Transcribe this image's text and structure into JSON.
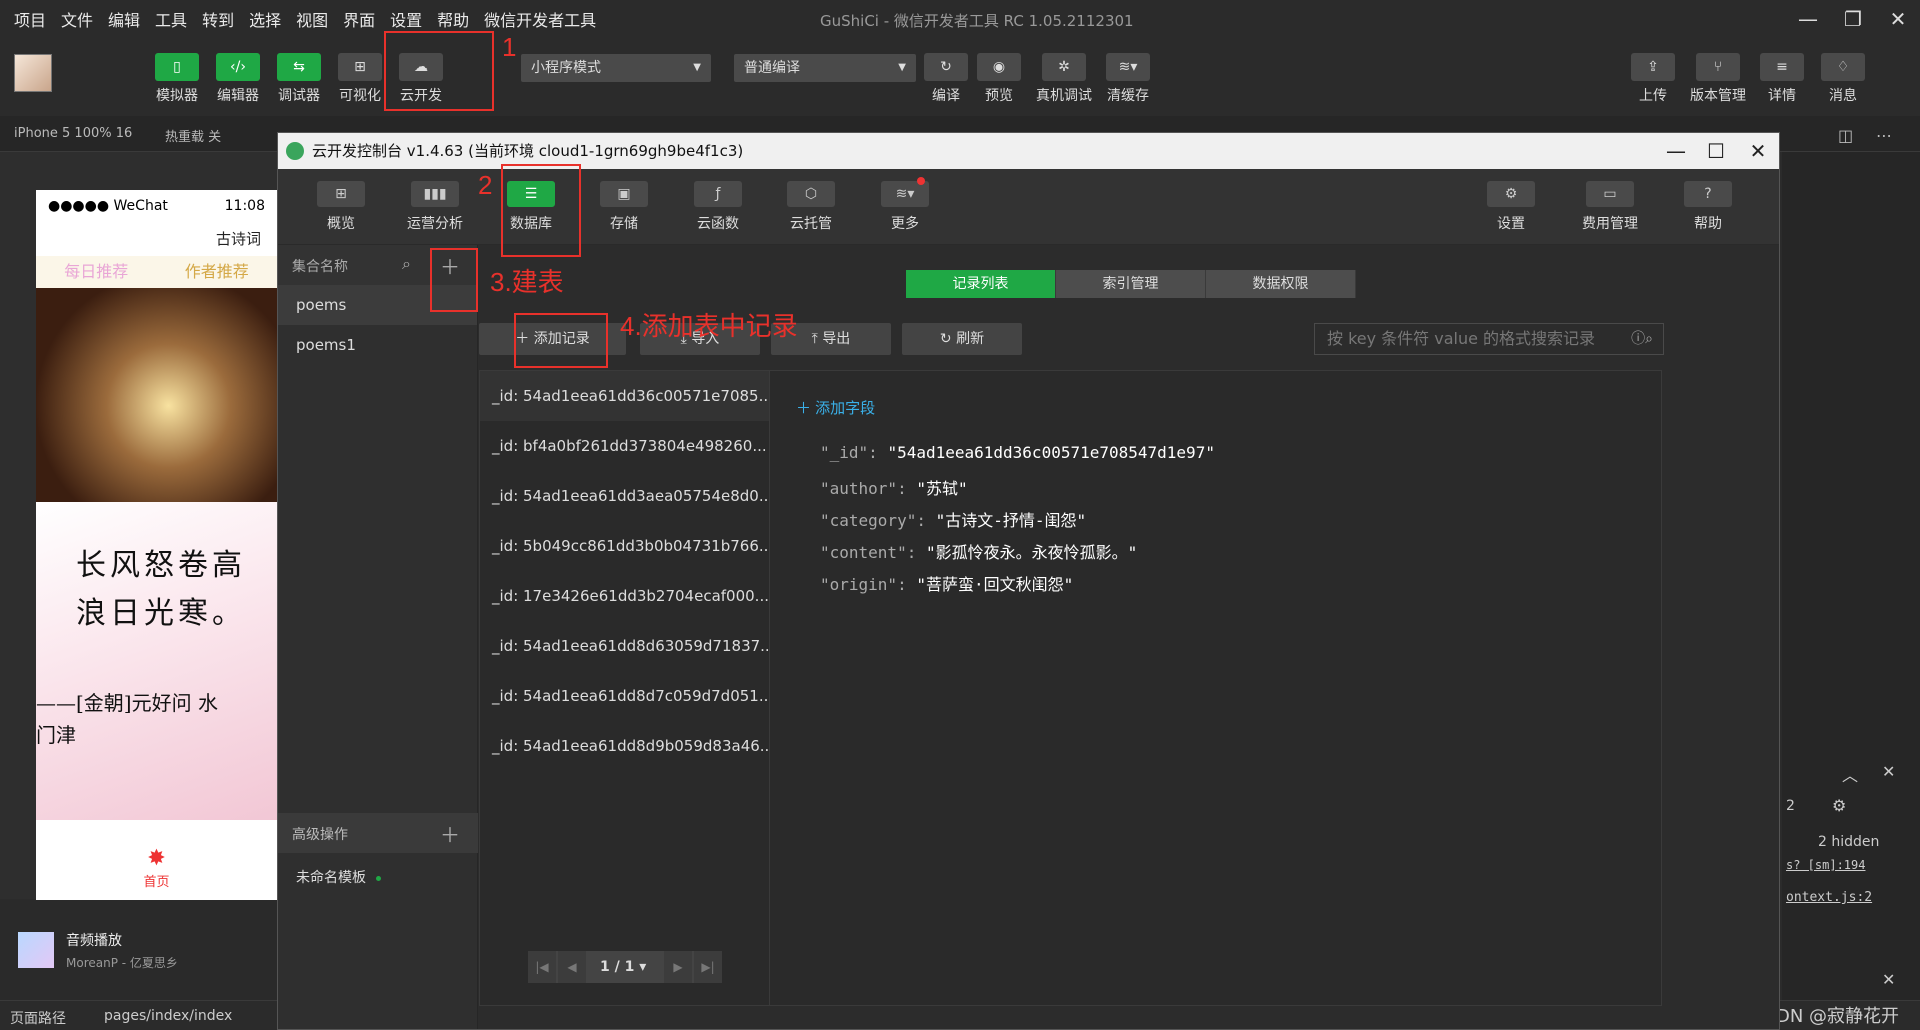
{
  "menubar": {
    "items": [
      "项目",
      "文件",
      "编辑",
      "工具",
      "转到",
      "选择",
      "视图",
      "界面",
      "设置",
      "帮助",
      "微信开发者工具"
    ],
    "title": "GuShiCi - 微信开发者工具 RC 1.05.2112301"
  },
  "toolbar": {
    "left": [
      "模拟器",
      "编辑器",
      "调试器",
      "可视化",
      "云开发"
    ],
    "mode_select": "小程序模式",
    "compile_select": "普通编译",
    "middle": [
      "编译",
      "预览",
      "真机调试",
      "清缓存"
    ],
    "right": [
      "上传",
      "版本管理",
      "详情",
      "消息"
    ]
  },
  "subbar": {
    "device": "iPhone 5 100% 16",
    "hot_reload": "热重载 关"
  },
  "phone": {
    "carrier": "●●●●● WeChat",
    "time": "11:08",
    "title": "古诗词",
    "tabs": [
      "每日推荐",
      "作者推荐"
    ],
    "poem_line1": "长风怒卷高",
    "poem_line2": "浪日光寒。",
    "poem_by": "——[金朝]元好问 水",
    "poem_by2": "门津",
    "home_label": "首页"
  },
  "audio": {
    "title": "音频播放",
    "subtitle": "MoreanP - 亿夏思乡"
  },
  "footer": {
    "path_label": "页面路径",
    "path": "pages/index/index",
    "watermark": "CSDN @寂静花开"
  },
  "right_panel": {
    "count": "2",
    "hidden": "2 hidden",
    "link1": "s? [sm]:194",
    "link2": "ontext.js:2"
  },
  "console": {
    "title": "云开发控制台 v1.4.63  (当前环境 cloud1-1grn69gh9be4f1c3)",
    "nav": [
      "概览",
      "运营分析",
      "数据库",
      "存储",
      "云函数",
      "云托管",
      "更多"
    ],
    "nav_right": [
      "设置",
      "费用管理",
      "帮助"
    ],
    "collection_header": "集合名称",
    "collections": [
      "poems",
      "poems1"
    ],
    "advanced": "高级操作",
    "template": "未命名模板",
    "tabs": [
      "记录列表",
      "索引管理",
      "数据权限"
    ],
    "actions": [
      "添加记录",
      "导入",
      "导出",
      "刷新"
    ],
    "search_placeholder": "按 key 条件符 value 的格式搜索记录",
    "records": [
      "_id: 54ad1eea61dd36c00571e7085...",
      "_id: bf4a0bf261dd373804e498260...",
      "_id: 54ad1eea61dd3aea05754e8d0...",
      "_id: 5b049cc861dd3b0b04731b766...",
      "_id: 17e3426e61dd3b2704ecaf000...",
      "_id: 54ad1eea61dd8d63059d71837...",
      "_id: 54ad1eea61dd8d7c059d7d051...",
      "_id: 54ad1eea61dd8d9b059d83a46..."
    ],
    "pager": "1 / 1",
    "add_field": "添加字段",
    "doc": {
      "id_key": "\"_id\":",
      "id_val": "\"54ad1eea61dd36c00571e708547d1e97\"",
      "author_key": "\"author\":",
      "author_val": "\"苏轼\"",
      "category_key": "\"category\":",
      "category_val": "\"古诗文-抒情-闺怨\"",
      "content_key": "\"content\":",
      "content_val": "\"影孤怜夜永。永夜怜孤影。\"",
      "origin_key": "\"origin\":",
      "origin_val": "\"菩萨蛮·回文秋闺怨\""
    }
  },
  "annotations": {
    "a1": "1",
    "a2": "2",
    "a3": "3.建表",
    "a4": "4.添加表中记录"
  },
  "colors": {
    "accent_green": "#1fa845",
    "annotation_red": "#e8312b"
  }
}
